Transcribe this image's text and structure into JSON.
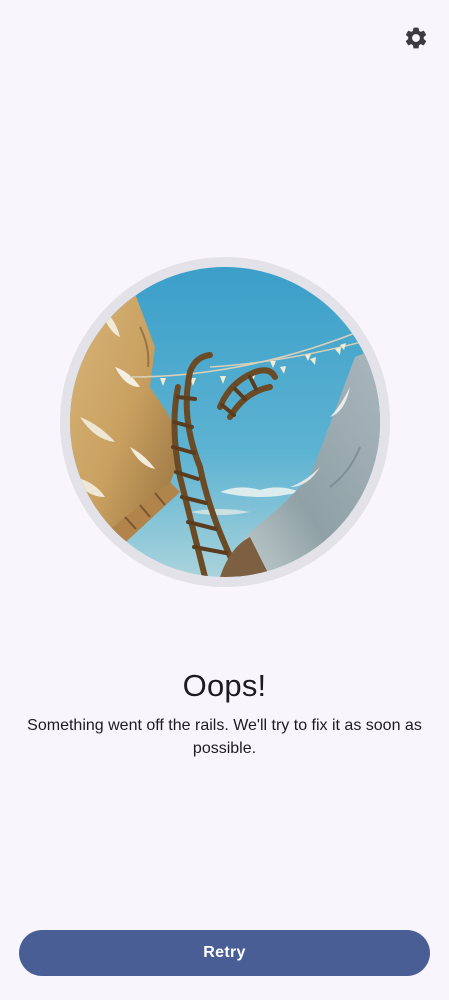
{
  "header": {
    "settings_icon": "gear-icon"
  },
  "error": {
    "title": "Oops!",
    "message": "Something went off the rails. We'll try to fix it as soon as possible."
  },
  "actions": {
    "retry_label": "Retry"
  },
  "colors": {
    "background": "#f8f6fc",
    "primary_button": "#4a5e96",
    "text": "#1d1b20"
  }
}
